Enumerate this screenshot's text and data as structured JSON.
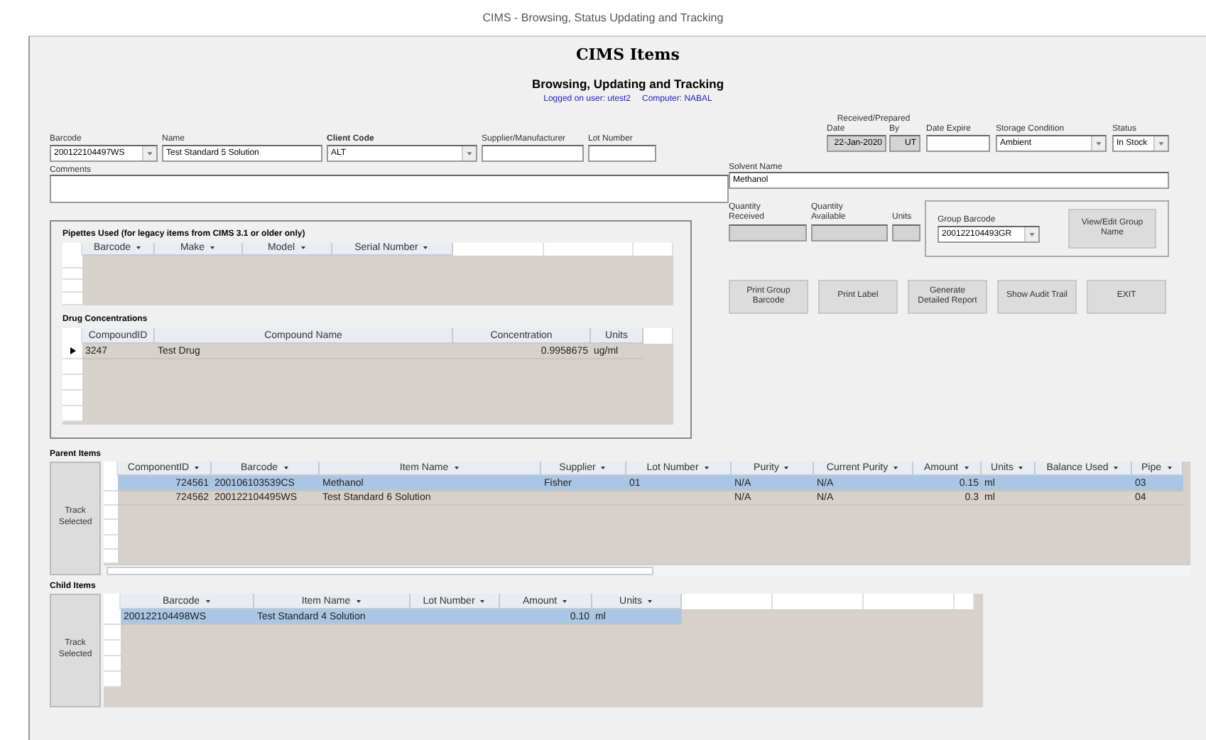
{
  "window": {
    "title": "CIMS - Browsing, Status Updating and Tracking"
  },
  "header": {
    "title": "CIMS Items",
    "subtitle": "Browsing, Updating and Tracking",
    "user": "Logged on user: utest2",
    "computer": "Computer: NABAL"
  },
  "fields": [
    {
      "label": "Barcode",
      "value": "200122104497WS",
      "kind": "dropdown"
    },
    {
      "label": "Name",
      "value": "Test Standard 5 Solution",
      "kind": "text"
    },
    {
      "label": "Client Code",
      "value": "ALT",
      "kind": "dropdown",
      "bold": true
    },
    {
      "label": "Supplier/Manufacturer",
      "kind": "text"
    },
    {
      "label": "Lot Number",
      "kind": "text"
    }
  ],
  "comments": {
    "label": "Comments"
  },
  "received_prepared": {
    "label": "Received/Prepared",
    "fields": [
      {
        "label": "Date",
        "value": "22-Jan-2020",
        "kind": "locked"
      },
      {
        "label": "By",
        "value": "UT",
        "kind": "locked"
      }
    ]
  },
  "right_fields": [
    {
      "label": "Date Expire",
      "kind": "text"
    },
    {
      "label": "Storage Condition",
      "value": "Ambient",
      "kind": "dropdown"
    },
    {
      "label": "Status",
      "value": "In Stock",
      "kind": "dropdown"
    }
  ],
  "solvent": {
    "label": "Solvent Name",
    "value": "Methanol"
  },
  "quantities": [
    {
      "label": "Quantity Received"
    },
    {
      "label": "Quantity Available"
    },
    {
      "label": "Units"
    }
  ],
  "group": {
    "label": "Group Barcode",
    "value": "200122104493GR",
    "button": "View/Edit Group Name"
  },
  "buttons": [
    "Print Group Barcode",
    "Print Label",
    "Generate Detailed Report",
    "Show Audit Trail",
    "EXIT"
  ],
  "pipettes": {
    "title": "Pipettes Used (for legacy items from CIMS 3.1 or older only)",
    "filter_arrows": true,
    "columns": [
      "Barcode",
      "Make",
      "Model",
      "Serial Number"
    ]
  },
  "drug_concentrations": {
    "title": "Drug Concentrations",
    "columns": [
      "CompoundID",
      "Compound Name",
      "Concentration",
      "Units"
    ],
    "rows": [
      {
        "cells": [
          "3247",
          "Test Drug",
          "0.9958675",
          "ug/ml"
        ],
        "selected": false,
        "current": true
      }
    ]
  },
  "parent_items": {
    "title": "Parent Items",
    "button": "Track Selected",
    "filter_arrows": true,
    "columns": [
      "ComponentID",
      "Barcode",
      "Item Name",
      "Supplier",
      "Lot Number",
      "Purity",
      "Current Purity",
      "Amount",
      "Units",
      "Balance Used",
      "Pipe"
    ],
    "rows": [
      {
        "cells": [
          "724561",
          "200106103539CS",
          "Methanol",
          "Fisher",
          "01",
          "N/A",
          "N/A",
          "0.15",
          "ml",
          "",
          "03"
        ],
        "selected": true
      },
      {
        "cells": [
          "724562",
          "200122104495WS",
          "Test Standard 6 Solution",
          "",
          "",
          "N/A",
          "N/A",
          "0.3",
          "ml",
          "",
          "04"
        ],
        "selected": false
      }
    ]
  },
  "child_items": {
    "title": "Child Items",
    "button": "Track Selected",
    "filter_arrows": true,
    "columns": [
      "Barcode",
      "Item Name",
      "Lot Number",
      "Amount",
      "Units"
    ],
    "rows": [
      {
        "cells": [
          "200122104498WS",
          "Test Standard 4 Solution",
          "",
          "0.10",
          "ml"
        ],
        "selected": true
      }
    ]
  }
}
